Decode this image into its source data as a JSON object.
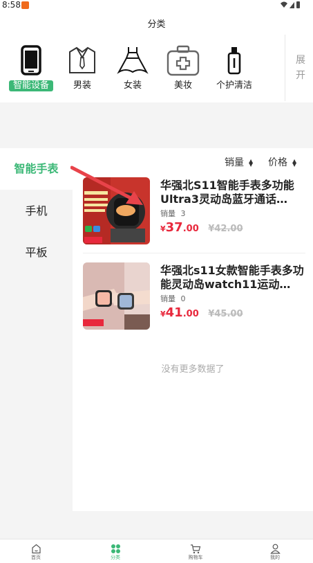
{
  "status_bar": {
    "time": "8:58"
  },
  "header": {
    "title": "分类"
  },
  "top_categories": [
    {
      "label": "智能设备",
      "icon": "phone-icon",
      "active": true
    },
    {
      "label": "男装",
      "icon": "shirt-icon",
      "active": false
    },
    {
      "label": "女装",
      "icon": "dress-icon",
      "active": false
    },
    {
      "label": "美妆",
      "icon": "first-aid-kit-icon",
      "active": false
    },
    {
      "label": "个护清洁",
      "icon": "bottle-icon",
      "active": false
    }
  ],
  "expand_label_1": "展",
  "expand_label_2": "开",
  "sub_categories": [
    {
      "label": "智能手表",
      "active": true
    },
    {
      "label": "手机",
      "active": false
    },
    {
      "label": "平板",
      "active": false
    }
  ],
  "sort": {
    "sales_label": "销量",
    "price_label": "价格"
  },
  "products": [
    {
      "title": "华强北S11智能手表多功能Ultra3灵动岛蓝牙通话…",
      "sales_label": "销量",
      "sales": "3",
      "currency": "¥",
      "price_int": "37",
      "price_dec": ".00",
      "original_price": "¥42.00"
    },
    {
      "title": "华强北s11女款智能手表多功能灵动岛watch11运动…",
      "sales_label": "销量",
      "sales": "0",
      "currency": "¥",
      "price_int": "41",
      "price_dec": ".00",
      "original_price": "¥45.00"
    }
  ],
  "no_more_text": "没有更多数据了",
  "tabbar": [
    {
      "label": "首页",
      "icon": "home-icon",
      "active": false
    },
    {
      "label": "分类",
      "icon": "category-icon",
      "active": true
    },
    {
      "label": "购物车",
      "icon": "cart-icon",
      "active": false
    },
    {
      "label": "我的",
      "icon": "profile-icon",
      "active": false
    }
  ],
  "colors": {
    "accent": "#3cb877",
    "price": "#e8283c",
    "panel_gray": "#f4f4f4"
  }
}
